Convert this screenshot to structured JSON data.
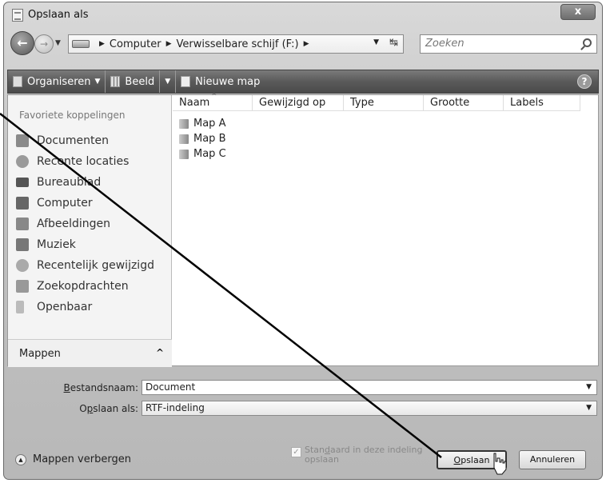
{
  "window": {
    "title": "Opslaan als",
    "close_label": "x"
  },
  "nav": {
    "back_icon": "back-arrow-icon",
    "breadcrumb": [
      "Computer",
      "Verwisselbare schijf (F:)"
    ],
    "search_placeholder": "Zoeken"
  },
  "toolbar": {
    "organize_label": "Organiseren",
    "view_label": "Beeld",
    "new_folder_label": "Nieuwe map",
    "help_label": "?"
  },
  "sidebar": {
    "title": "Favoriete koppelingen",
    "items": [
      {
        "label": "Documenten",
        "icon": "documents-icon",
        "color": "#8a8a8a"
      },
      {
        "label": "Recente locaties",
        "icon": "recent-places-icon",
        "color": "#9a9a9a"
      },
      {
        "label": "Bureaublad",
        "icon": "desktop-icon",
        "color": "#555555"
      },
      {
        "label": "Computer",
        "icon": "computer-icon",
        "color": "#666666"
      },
      {
        "label": "Afbeeldingen",
        "icon": "pictures-icon",
        "color": "#888888"
      },
      {
        "label": "Muziek",
        "icon": "music-icon",
        "color": "#777777"
      },
      {
        "label": "Recentelijk gewijzigd",
        "icon": "recently-changed-icon",
        "color": "#aaaaaa"
      },
      {
        "label": "Zoekopdrachten",
        "icon": "searches-icon",
        "color": "#999999"
      },
      {
        "label": "Openbaar",
        "icon": "public-icon",
        "color": "#bbbbbb"
      }
    ],
    "folders_label": "Mappen",
    "folders_chevron": "^"
  },
  "files": {
    "columns": [
      "Naam",
      "Gewijzigd op",
      "Type",
      "Grootte",
      "Labels"
    ],
    "items": [
      "Map A",
      "Map B",
      "Map C"
    ]
  },
  "form": {
    "filename_label_u": "B",
    "filename_label_rest": "estandsnaam:",
    "filename_value": "Document",
    "savetype_label_pre": "O",
    "savetype_label_u": "p",
    "savetype_label_rest": "slaan als:",
    "savetype_value": "RTF-indeling"
  },
  "footer": {
    "hide_folders_label": "Mappen verbergen",
    "default_check_line1_pre": "Stan",
    "default_check_line1_u": "d",
    "default_check_line1_rest": "aard in deze indeling",
    "default_check_line2": "opslaan",
    "default_checked_mark": "✓",
    "save_label_u": "O",
    "save_label_rest": "pslaan",
    "cancel_label": "Annuleren"
  }
}
